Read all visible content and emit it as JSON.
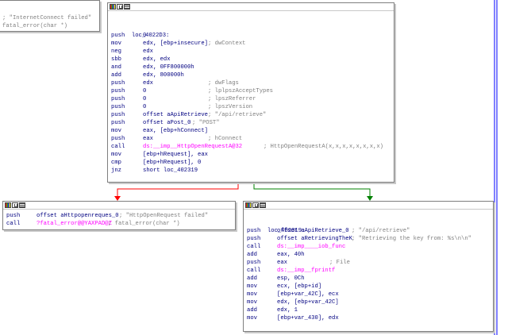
{
  "nodes": {
    "top_left": {
      "lines": [
        {
          "comment": "; \"InternetConnect failed\""
        },
        {
          "comment": "fatal_error(char *)"
        }
      ]
    },
    "main": {
      "label": "loc_4022D3:",
      "label_comment": "; dwContext",
      "lines": [
        {
          "m": "push",
          "op": "0",
          "c": ""
        },
        {
          "m": "mov",
          "op": "edx, [ebp+insecure]",
          "c": ""
        },
        {
          "m": "neg",
          "op": "edx",
          "c": ""
        },
        {
          "m": "sbb",
          "op": "edx, edx",
          "c": ""
        },
        {
          "m": "and",
          "op": "edx, 0FF800000h",
          "c": ""
        },
        {
          "m": "add",
          "op": "edx, 800000h",
          "c": ""
        },
        {
          "m": "push",
          "op": "edx",
          "c": "; dwFlags"
        },
        {
          "m": "push",
          "op": "0",
          "c": "; lplpszAcceptTypes"
        },
        {
          "m": "push",
          "op": "0",
          "c": "; lpszReferrer"
        },
        {
          "m": "push",
          "op": "0",
          "c": "; lpszVersion"
        },
        {
          "m": "push",
          "op": "offset aApiRetrieve",
          "c": "; \"/api/retrieve\""
        },
        {
          "m": "push",
          "op": "offset aPost_0",
          "c": "; \"POST\""
        },
        {
          "m": "mov",
          "op": "eax, [ebp+hConnect]",
          "c": ""
        },
        {
          "m": "push",
          "op": "eax",
          "c": "; hConnect"
        },
        {
          "m": "call",
          "op": "ds:__imp__HttpOpenRequestA@32",
          "c": "; HttpOpenRequestA(x,x,x,x,x,x,x,x)"
        },
        {
          "m": "mov",
          "op": "[ebp+hRequest], eax",
          "c": ""
        },
        {
          "m": "cmp",
          "op": "[ebp+hRequest], 0",
          "c": ""
        },
        {
          "m": "jnz",
          "op": "short loc_402319",
          "c": ""
        }
      ]
    },
    "fail": {
      "lines": [
        {
          "m": "push",
          "op": "offset aHttpopenreques_0",
          "c": "; \"HttpOpenRequest failed\""
        },
        {
          "m": "call",
          "op": "?fatal_error@@YAXPAD@Z",
          "c": "; fatal_error(char *)"
        }
      ]
    },
    "success": {
      "label": "loc_402319:",
      "lines": [
        {
          "m": "push",
          "op": "offset aApiRetrieve_0",
          "c": "; \"/api/retrieve\""
        },
        {
          "m": "push",
          "op": "offset aRetrievingTheK",
          "c": "; \"Retrieving the key from: %s\\n\\n\""
        },
        {
          "m": "call",
          "op": "ds:__imp____iob_func",
          "c": ""
        },
        {
          "m": "add",
          "op": "eax, 40h",
          "c": ""
        },
        {
          "m": "push",
          "op": "eax",
          "c": "; File"
        },
        {
          "m": "call",
          "op": "ds:__imp__fprintf",
          "c": ""
        },
        {
          "m": "add",
          "op": "esp, 0Ch",
          "c": ""
        },
        {
          "m": "mov",
          "op": "ecx, [ebp+id]",
          "c": ""
        },
        {
          "m": "mov",
          "op": "[ebp+var_42C], ecx",
          "c": ""
        },
        {
          "m": "mov",
          "op": "edx, [ebp+var_42C]",
          "c": ""
        },
        {
          "m": "add",
          "op": "edx, 1",
          "c": ""
        },
        {
          "m": "mov",
          "op": "[ebp+var_430], edx",
          "c": ""
        }
      ]
    }
  },
  "edges": {
    "false_color": "#ff0000",
    "true_color": "#008000",
    "loop_color": "#0000ff"
  }
}
